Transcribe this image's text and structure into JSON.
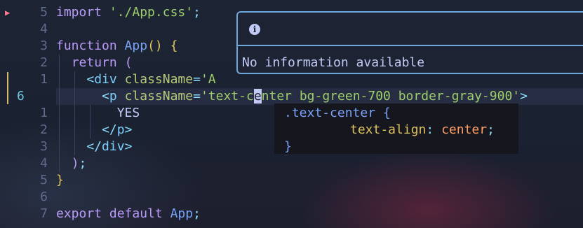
{
  "editor": {
    "lines": [
      {
        "num": "5",
        "tokens": [
          {
            "t": "import",
            "c": "kw"
          },
          {
            "t": " ",
            "c": "txt"
          },
          {
            "t": "'./App.css'",
            "c": "str"
          },
          {
            "t": ";",
            "c": "punc"
          }
        ]
      },
      {
        "num": "4",
        "tokens": []
      },
      {
        "num": "3",
        "tokens": [
          {
            "t": "function",
            "c": "kw"
          },
          {
            "t": " ",
            "c": "txt"
          },
          {
            "t": "App",
            "c": "fn"
          },
          {
            "t": "()",
            "c": "paren"
          },
          {
            "t": " ",
            "c": "txt"
          },
          {
            "t": "{",
            "c": "paren"
          }
        ]
      },
      {
        "num": "2",
        "tokens": [
          {
            "t": "  ",
            "c": "txt"
          },
          {
            "t": "return",
            "c": "kw"
          },
          {
            "t": " ",
            "c": "txt"
          },
          {
            "t": "(",
            "c": "kw"
          }
        ]
      },
      {
        "num": "1",
        "tokens": [
          {
            "t": "    ",
            "c": "txt"
          },
          {
            "t": "<",
            "c": "punc"
          },
          {
            "t": "div",
            "c": "tag"
          },
          {
            "t": " ",
            "c": "txt"
          },
          {
            "t": "className",
            "c": "attr"
          },
          {
            "t": "=",
            "c": "punc"
          },
          {
            "t": "'A",
            "c": "str"
          }
        ]
      },
      {
        "num": "6",
        "current": true,
        "tokens": [
          {
            "t": "      ",
            "c": "txt"
          },
          {
            "t": "<",
            "c": "punc"
          },
          {
            "t": "p",
            "c": "tag"
          },
          {
            "t": " ",
            "c": "txt"
          },
          {
            "t": "className",
            "c": "attr"
          },
          {
            "t": "=",
            "c": "punc"
          },
          {
            "t": "'text-c",
            "c": "str"
          },
          {
            "t": "e",
            "c": "cursor"
          },
          {
            "t": "nter bg-green-700 border-gray-900'",
            "c": "str"
          },
          {
            "t": ">",
            "c": "punc"
          }
        ]
      },
      {
        "num": "1",
        "tokens": [
          {
            "t": "        ",
            "c": "txt"
          },
          {
            "t": "YES",
            "c": "txt"
          }
        ]
      },
      {
        "num": "2",
        "tokens": [
          {
            "t": "      ",
            "c": "txt"
          },
          {
            "t": "</",
            "c": "punc"
          },
          {
            "t": "p",
            "c": "tag"
          },
          {
            "t": ">",
            "c": "punc"
          }
        ]
      },
      {
        "num": "3",
        "tokens": [
          {
            "t": "    ",
            "c": "txt"
          },
          {
            "t": "</",
            "c": "punc"
          },
          {
            "t": "div",
            "c": "tag"
          },
          {
            "t": ">",
            "c": "punc"
          }
        ]
      },
      {
        "num": "4",
        "tokens": [
          {
            "t": "  ",
            "c": "txt"
          },
          {
            "t": ")",
            "c": "kw"
          },
          {
            "t": ";",
            "c": "punc"
          }
        ]
      },
      {
        "num": "5",
        "tokens": [
          {
            "t": "}",
            "c": "paren"
          }
        ]
      },
      {
        "num": "6",
        "tokens": []
      },
      {
        "num": "7",
        "tokens": [
          {
            "t": "export",
            "c": "kw"
          },
          {
            "t": " ",
            "c": "txt"
          },
          {
            "t": "default",
            "c": "kw"
          },
          {
            "t": " ",
            "c": "txt"
          },
          {
            "t": "App",
            "c": "fn"
          },
          {
            "t": ";",
            "c": "punc"
          }
        ]
      }
    ]
  },
  "hover": {
    "icon": "info-icon",
    "icon_glyph": "i",
    "message": "No information available"
  },
  "css_popup": {
    "selector": ".text-center",
    "open_brace": "{",
    "property": "text-align",
    "colon": ":",
    "value": "center",
    "semicolon": ";",
    "close_brace": "}"
  },
  "colors": {
    "accent_border": "#6fa8dc",
    "modified_marker": "#d9b86a",
    "git_marker": "#ff7a93"
  }
}
